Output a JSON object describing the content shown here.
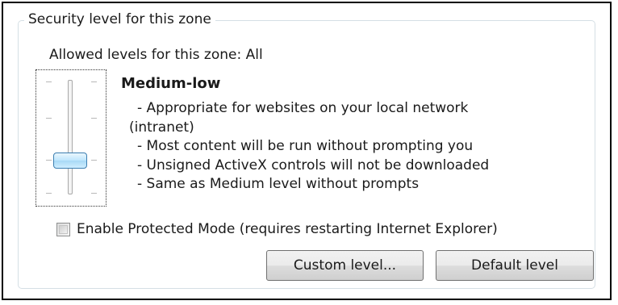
{
  "group": {
    "title": "Security level for this zone"
  },
  "allowed_levels": "Allowed levels for this zone: All",
  "slider": {
    "level_index": 1,
    "level_count": 4
  },
  "level": {
    "name": "Medium-low",
    "description": [
      "- Appropriate for websites on your local network",
      "(intranet)",
      "- Most content will be run without prompting you",
      "- Unsigned ActiveX controls will not be downloaded",
      "- Same as Medium level without prompts"
    ]
  },
  "protected_mode": {
    "label": "Enable Protected Mode (requires restarting Internet Explorer)",
    "checked": false
  },
  "buttons": {
    "custom_level": "Custom level...",
    "default_level": "Default level"
  },
  "colors": {
    "group_border": "#d5dfe5",
    "thumb_border": "#3c7fb1",
    "thumb_fill": "#bee6fd"
  }
}
